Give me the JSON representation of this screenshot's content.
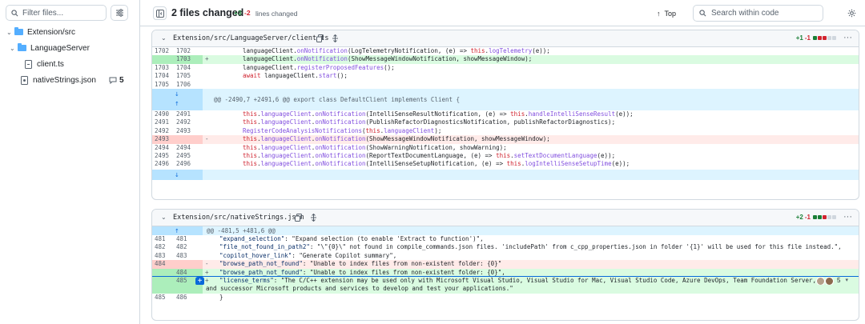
{
  "sidebar": {
    "filter_placeholder": "Filter files...",
    "tree": {
      "folder1": "Extension/src",
      "folder2": "LanguageServer",
      "file1": "client.ts",
      "file2": "nativeStrings.json",
      "file2_comments": "5"
    }
  },
  "topbar": {
    "title": "2 files changed",
    "additions": "+3",
    "deletions": "-2",
    "lines_label": "lines changed",
    "top_label": "Top",
    "search_placeholder": "Search within code"
  },
  "files": [
    {
      "path": "Extension/src/LanguageServer/client.ts",
      "stat_add": "+1",
      "stat_del": "-1",
      "stat_colors": [
        "#1a7f37",
        "#d1242f",
        "#d1242f",
        "#d0d7de",
        "#d0d7de"
      ],
      "hunk": "@@ -2490,7 +2491,6 @@ export class DefaultClient implements Client {",
      "lines": [
        {
          "type": "ctx",
          "o": "1702",
          "n": "1702",
          "m": "",
          "code": "languageClient.onNotification(LogTelemetryNotification, (e) => this.logTelemetry(e));"
        },
        {
          "type": "add",
          "o": "",
          "n": "1703",
          "m": "+",
          "code": "languageClient.onNotification(ShowMessageWindowNotification, showMessageWindow);"
        },
        {
          "type": "ctx",
          "o": "1703",
          "n": "1704",
          "m": "",
          "code": "languageClient.registerProposedFeatures();"
        },
        {
          "type": "ctx",
          "o": "1704",
          "n": "1705",
          "m": "",
          "code": "await languageClient.start();"
        },
        {
          "type": "ctx",
          "o": "1705",
          "n": "1706",
          "m": "",
          "code": ""
        },
        {
          "type": "ctx",
          "o": "2490",
          "n": "2491",
          "m": "",
          "code": "this.languageClient.onNotification(IntelliSenseResultNotification, (e) => this.handleIntelliSenseResult(e));"
        },
        {
          "type": "ctx",
          "o": "2491",
          "n": "2492",
          "m": "",
          "code": "this.languageClient.onNotification(PublishRefactorDiagnosticsNotification, publishRefactorDiagnostics);"
        },
        {
          "type": "ctx",
          "o": "2492",
          "n": "2493",
          "m": "",
          "code": "RegisterCodeAnalysisNotifications(this.languageClient);"
        },
        {
          "type": "del",
          "o": "2493",
          "n": "",
          "m": "-",
          "code": "this.languageClient.onNotification(ShowMessageWindowNotification, showMessageWindow);"
        },
        {
          "type": "ctx",
          "o": "2494",
          "n": "2494",
          "m": "",
          "code": "this.languageClient.onNotification(ShowWarningNotification, showWarning);"
        },
        {
          "type": "ctx",
          "o": "2495",
          "n": "2495",
          "m": "",
          "code": "this.languageClient.onNotification(ReportTextDocumentLanguage, (e) => this.setTextDocumentLanguage(e));"
        },
        {
          "type": "ctx",
          "o": "2496",
          "n": "2496",
          "m": "",
          "code": "this.languageClient.onNotification(IntelliSenseSetupNotification, (e) => this.logIntelliSenseSetupTime(e));"
        }
      ]
    },
    {
      "path": "Extension/src/nativeStrings.json",
      "stat_add": "+2",
      "stat_del": "-1",
      "stat_colors": [
        "#1a7f37",
        "#1a7f37",
        "#d1242f",
        "#d0d7de",
        "#d0d7de"
      ],
      "hunk": "@@ -481,5 +481,6 @@",
      "comment_count": "5",
      "lines": [
        {
          "type": "ctx",
          "o": "481",
          "n": "481",
          "m": "",
          "code": "\"expand_selection\": \"Expand selection (to enable 'Extract to function')\","
        },
        {
          "type": "ctx",
          "o": "482",
          "n": "482",
          "m": "",
          "code": "\"file_not_found_in_path2\": \"\\\"{0}\\\" not found in compile_commands.json files. 'includePath' from c_cpp_properties.json in folder '{1}' will be used for this file instead.\","
        },
        {
          "type": "ctx",
          "o": "483",
          "n": "483",
          "m": "",
          "code": "\"copilot_hover_link\": \"Generate Copilot summary\","
        },
        {
          "type": "del",
          "o": "484",
          "n": "",
          "m": "-",
          "code": "\"browse_path_not_found\": \"Unable to index files from non-existent folder: {0}\""
        },
        {
          "type": "add",
          "o": "",
          "n": "484",
          "m": "+",
          "code": "\"browse_path_not_found\": \"Unable to index files from non-existent folder: {0}\","
        },
        {
          "type": "add",
          "o": "",
          "n": "485",
          "m": "+",
          "code": "\"license_terms\": \"The C/C++ extension may be used only with Microsoft Visual Studio, Visual Studio for Mac, Visual Studio Code, Azure DevOps, Team Foundation Server,"
        },
        {
          "type": "addwrap",
          "o": "",
          "n": "",
          "m": "",
          "code": "and successor Microsoft products and services to develop and test your applications.\""
        },
        {
          "type": "ctx",
          "o": "485",
          "n": "486",
          "m": "",
          "code": "}"
        }
      ]
    }
  ]
}
